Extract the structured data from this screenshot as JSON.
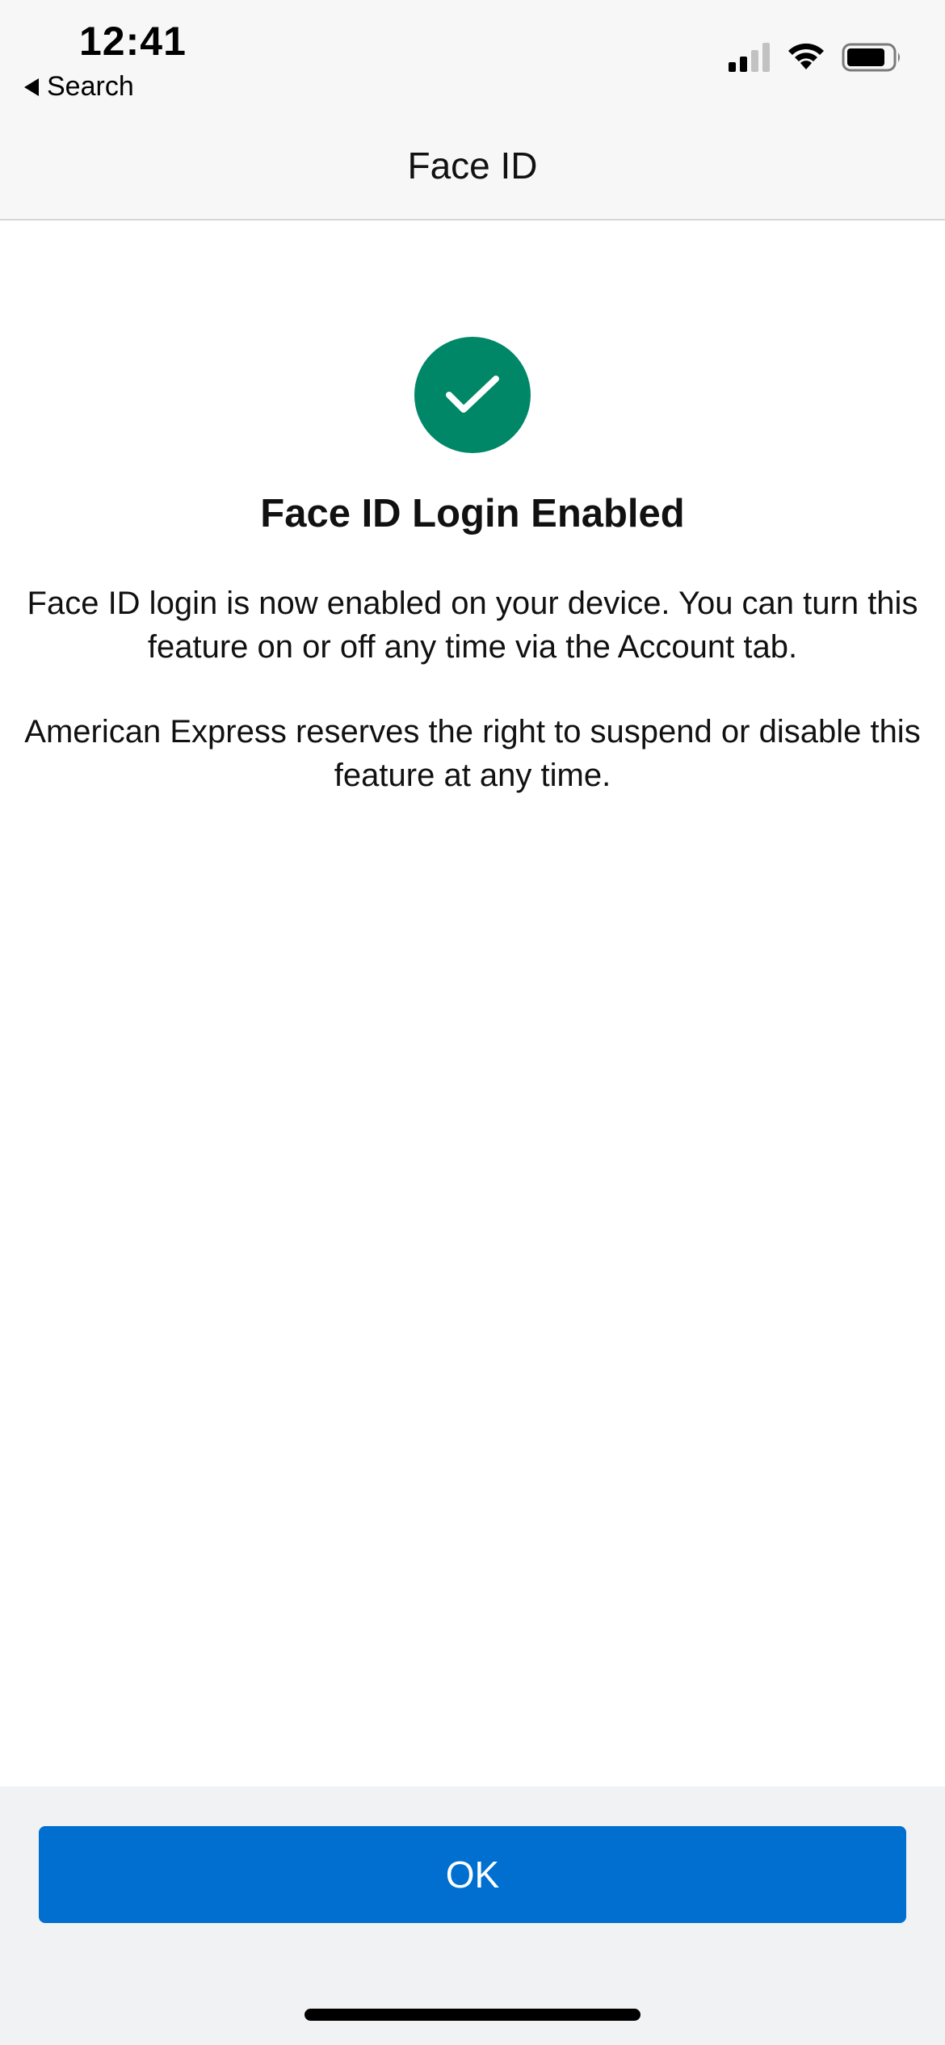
{
  "status_bar": {
    "time": "12:41",
    "back_label": "Search",
    "icons": [
      "cellular-signal-icon",
      "wifi-icon",
      "battery-icon"
    ]
  },
  "nav": {
    "title": "Face ID"
  },
  "main": {
    "icon": "checkmark-circle-icon",
    "headline": "Face ID Login Enabled",
    "paragraph_1": "Face ID login is now enabled on your device. You can turn this feature on or off any time via the Account tab.",
    "paragraph_2": "American Express reserves the right to suspend or disable this feature at any time."
  },
  "footer": {
    "ok_label": "OK"
  },
  "colors": {
    "accent_blue": "#006fcf",
    "success_green": "#008767",
    "footer_background": "#f1f2f3",
    "header_background": "#f7f7f7"
  }
}
